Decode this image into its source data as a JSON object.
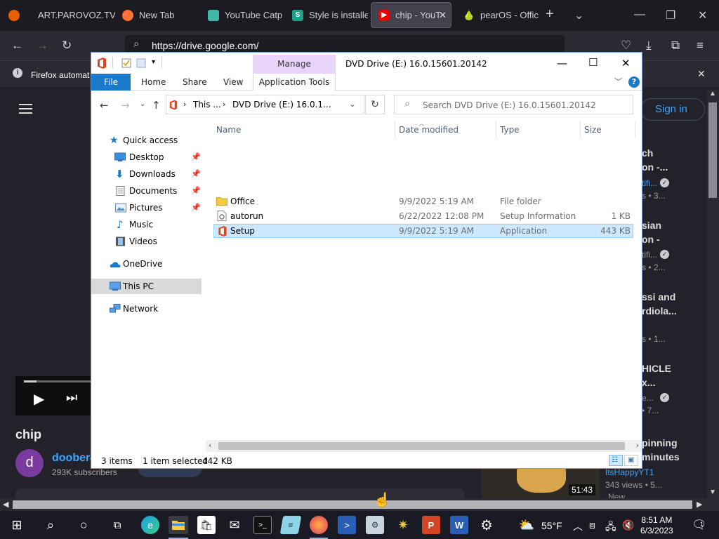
{
  "firefox": {
    "tabs": [
      {
        "label": "ART.PAROVOZ.TV",
        "icon": "firefox-logo-icon"
      },
      {
        "label": "New Tab",
        "icon": "firefox-icon"
      },
      {
        "label": "YouTube Catp",
        "icon": "catpuccin-icon"
      },
      {
        "label": "Style is installe",
        "icon": "stylus-icon"
      },
      {
        "label": "chip - YouT",
        "icon": "youtube-icon"
      },
      {
        "label": "pearOS - Offic",
        "icon": "pear-icon"
      }
    ],
    "url": "https://drive.google.com/",
    "notification": "Firefox automat"
  },
  "youtube": {
    "signin": "Sign in",
    "video_title": "chip",
    "channel": "doober4",
    "avatar_letter": "d",
    "subscribers": "293K subscribers",
    "sidebar": [
      {
        "l1": "ch",
        "l2": "on -...",
        "sub1": "tifi...",
        "sub2": "s • 3..."
      },
      {
        "l1": "sian",
        "l2": "on -",
        "sub1": "tifi...",
        "sub2": "s • 2..."
      },
      {
        "l1": "ssi and",
        "l2": "rdiola...",
        "sub1": "",
        "sub2": "s • 1..."
      },
      {
        "l1": "HICLE",
        "l2": "x...",
        "sub1": "e...",
        "sub2": "• 7..."
      },
      {
        "l1": "pinning",
        "l2": "minutes",
        "sub1": "ItsHappyYT1",
        "sub2": "343 views • 5..."
      }
    ],
    "duration": "51:43",
    "new_badge": "New"
  },
  "explorer": {
    "manage": "Manage",
    "title": "DVD Drive (E:) 16.0.15601.20142",
    "ribbon": {
      "file": "File",
      "home": "Home",
      "share": "Share",
      "view": "View",
      "app_tools": "Application Tools"
    },
    "address": {
      "this_pc": "This ...",
      "drive": "DVD Drive (E:) 16.0.1..."
    },
    "search_placeholder": "Search DVD Drive (E:) 16.0.15601.20142",
    "nav": [
      {
        "label": "Quick access",
        "icon": "quick-access-star-icon",
        "pinned": false
      },
      {
        "label": "Desktop",
        "icon": "desktop-icon",
        "pinned": true
      },
      {
        "label": "Downloads",
        "icon": "downloads-icon",
        "pinned": true
      },
      {
        "label": "Documents",
        "icon": "documents-icon",
        "pinned": true
      },
      {
        "label": "Pictures",
        "icon": "pictures-icon",
        "pinned": true
      },
      {
        "label": "Music",
        "icon": "music-icon",
        "pinned": false
      },
      {
        "label": "Videos",
        "icon": "videos-icon",
        "pinned": false
      },
      {
        "label": "OneDrive",
        "icon": "onedrive-cloud-icon",
        "pinned": false
      },
      {
        "label": "This PC",
        "icon": "this-pc-icon",
        "pinned": false
      },
      {
        "label": "Network",
        "icon": "network-icon",
        "pinned": false
      }
    ],
    "columns": {
      "name": "Name",
      "date": "Date modified",
      "type": "Type",
      "size": "Size"
    },
    "files": [
      {
        "name": "Office",
        "date": "9/9/2022 5:19 AM",
        "type": "File folder",
        "size": "",
        "icon": "folder-icon"
      },
      {
        "name": "autorun",
        "date": "6/22/2022 12:08 PM",
        "type": "Setup Information",
        "size": "1 KB",
        "icon": "setup-info-file-icon"
      },
      {
        "name": "Setup",
        "date": "9/9/2022 5:19 AM",
        "type": "Application",
        "size": "443 KB",
        "icon": "office-app-icon"
      }
    ],
    "status": {
      "items": "3 items",
      "selected": "1 item selected",
      "sel_size": "442 KB"
    }
  },
  "taskbar": {
    "temperature": "55°F",
    "time": "8:51 AM",
    "date": "6/3/2023",
    "notifications": "1"
  },
  "colors": {
    "accent": "#1979ca",
    "manage": "#e9d4fb",
    "selection": "#cce8ff",
    "taskbar": "#1a1a24"
  }
}
